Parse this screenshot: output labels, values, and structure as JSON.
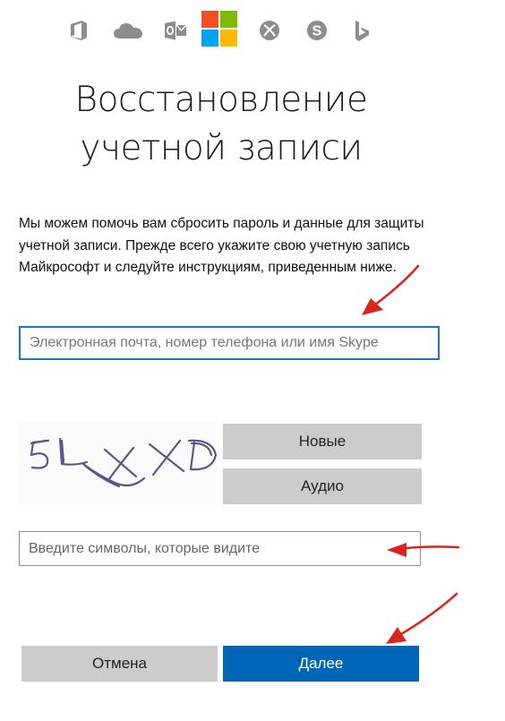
{
  "header": {
    "products": [
      "office-icon",
      "onedrive-icon",
      "outlook-icon",
      "microsoft-logo",
      "xbox-icon",
      "skype-icon",
      "bing-icon"
    ],
    "logo_colors": [
      "#f25022",
      "#7fba00",
      "#00a4ef",
      "#ffb900"
    ],
    "icon_color": "#8d8d8d"
  },
  "page": {
    "title_line1": "Восстановление",
    "title_line2": "учетной записи",
    "description": "Мы можем помочь вам сбросить пароль и данные для защиты учетной записи. Прежде всего укажите свою учетную запись Майкрософт и следуйте инструкциям, приведенным ниже."
  },
  "form": {
    "account_placeholder": "Электронная почта, номер телефона или имя Skype",
    "account_value": "",
    "captcha_text": "5L XXD",
    "new_label": "Новые",
    "audio_label": "Аудио",
    "chars_placeholder": "Введите символы, которые видите",
    "chars_value": ""
  },
  "footer": {
    "cancel_label": "Отмена",
    "next_label": "Далее"
  },
  "colors": {
    "primary": "#0067b8",
    "button_gray": "#cccccc",
    "focus_border": "#1f74c2",
    "annotation_arrow": "#d9251d"
  }
}
